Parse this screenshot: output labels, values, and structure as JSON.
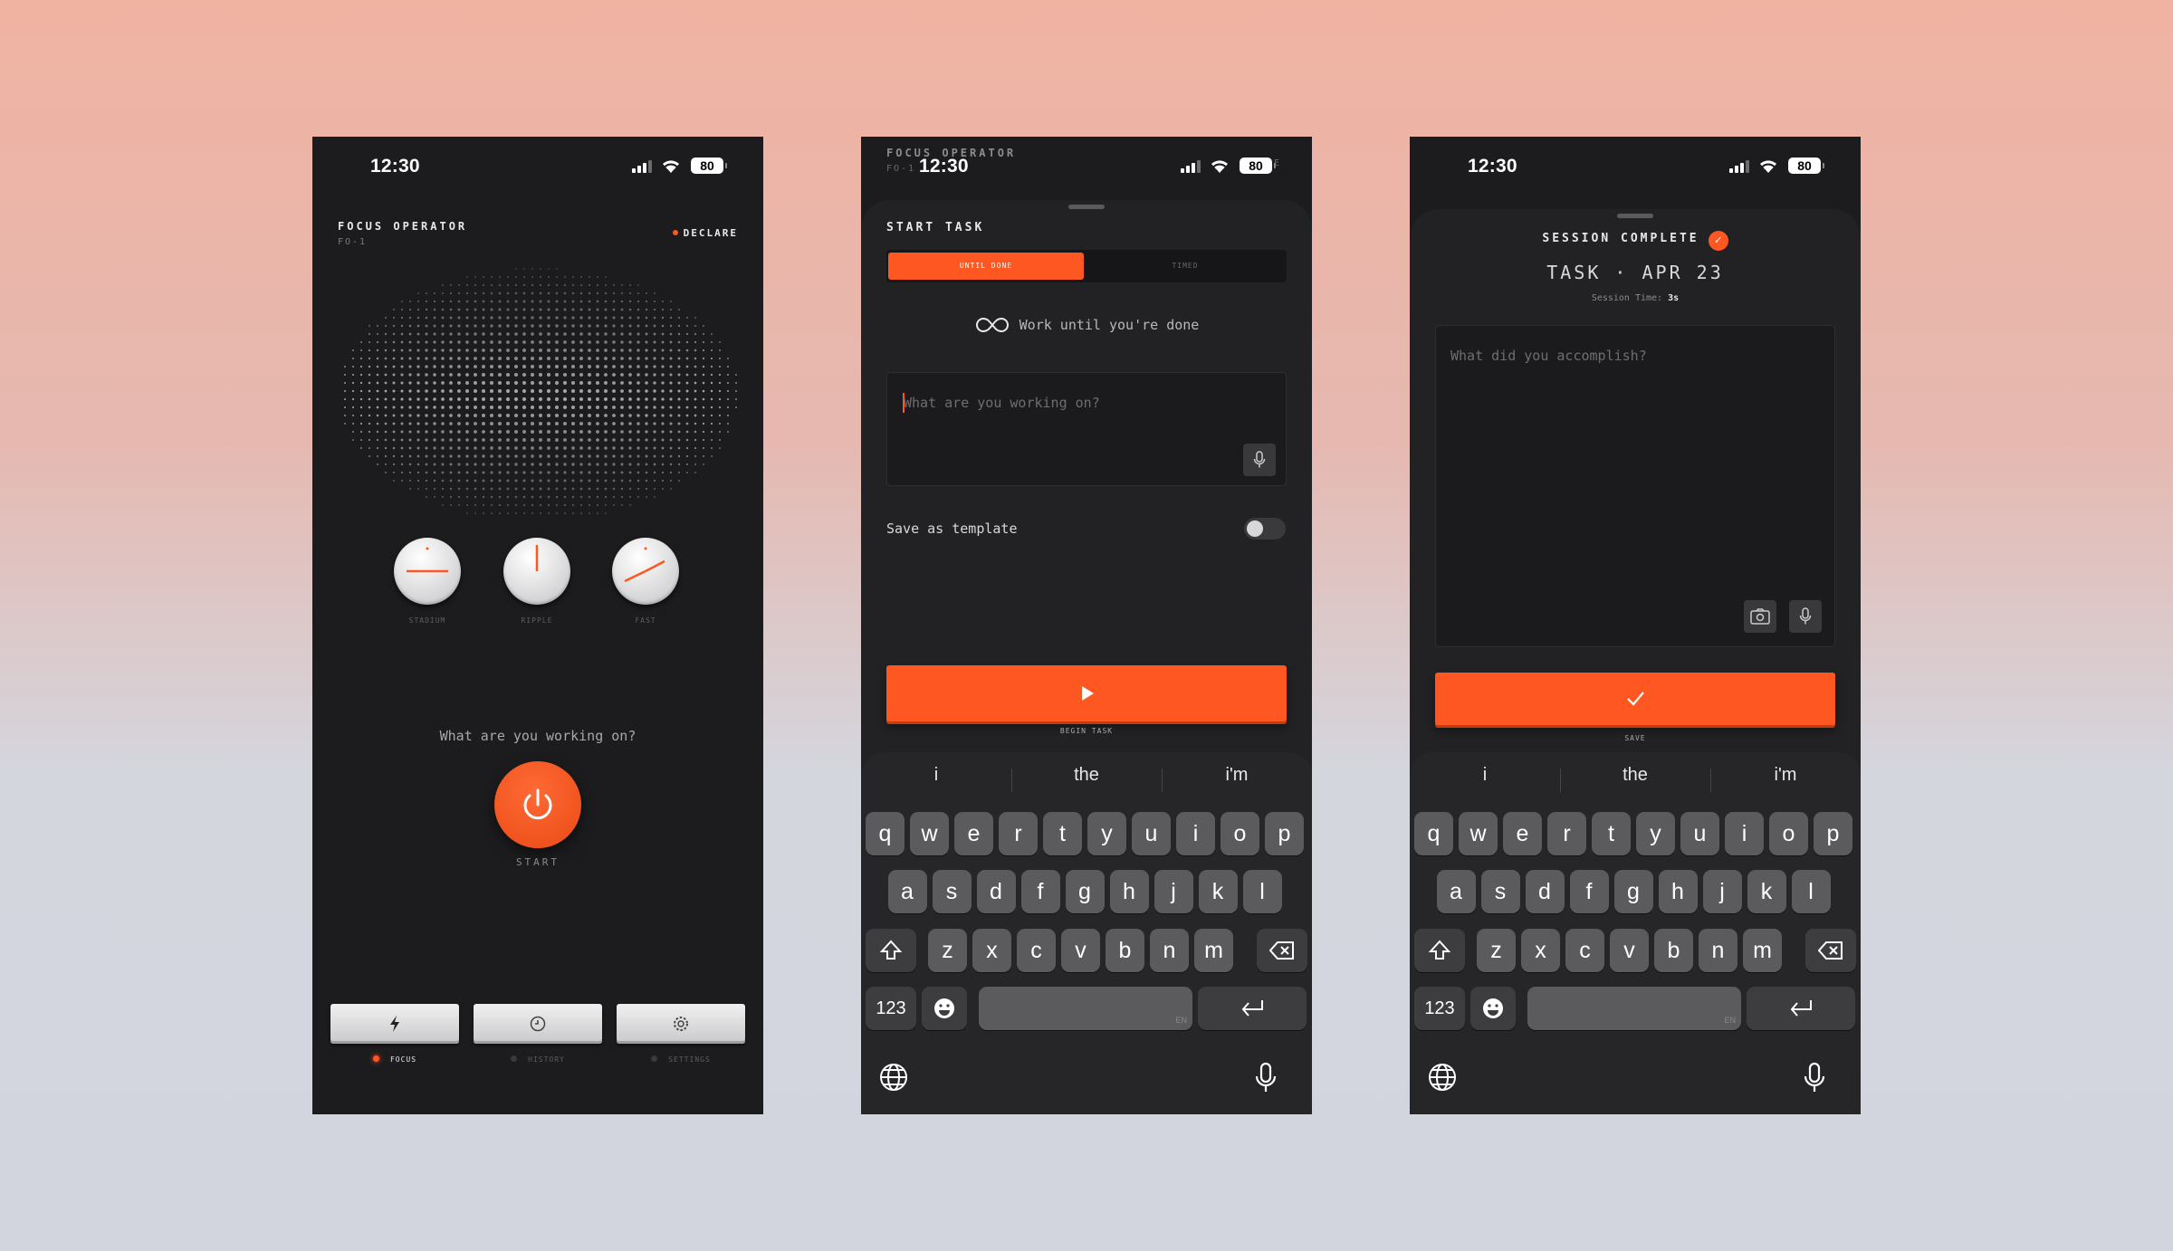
{
  "status": {
    "time": "12:30",
    "battery": "80"
  },
  "colors": {
    "accent": "#ff5722",
    "bg": "#1c1c1e",
    "knob": "#e0e0e2"
  },
  "focus_screen": {
    "title": "FOCUS OPERATOR",
    "subtitle": "FO-1",
    "declare": "DECLARE",
    "knobs": [
      {
        "label": "STADIUM",
        "icon": "dial-icon"
      },
      {
        "label": "RIPPLE",
        "icon": "dial-icon"
      },
      {
        "label": "FAST",
        "icon": "dial-icon"
      }
    ],
    "prompt": "What are you working on?",
    "start_label": "START",
    "nav": [
      {
        "label": "FOCUS",
        "icon": "lightning-icon",
        "active": true
      },
      {
        "label": "HISTORY",
        "icon": "clock-icon",
        "active": false
      },
      {
        "label": "SETTINGS",
        "icon": "gear-icon",
        "active": false
      }
    ]
  },
  "start_task_screen": {
    "bg_title": "FOCUS OPERATOR",
    "bg_subtitle": "FO-1",
    "bg_declare_fragment": "RE",
    "title": "START TASK",
    "tabs": [
      "UNTIL DONE",
      "TIMED"
    ],
    "mode_text": "Work until you're done",
    "input_placeholder": "What are you working on?",
    "template_label": "Save as template",
    "template_enabled": false,
    "begin_label": "BEGIN TASK"
  },
  "session_screen": {
    "title": "SESSION COMPLETE",
    "task_title": "TASK · APR 23",
    "session_time_label": "Session Time:",
    "session_time_value": "3s",
    "input_placeholder": "What did you accomplish?",
    "save_label": "SAVE"
  },
  "keyboard": {
    "suggestions": [
      "i",
      "the",
      "i'm"
    ],
    "row1": [
      "q",
      "w",
      "e",
      "r",
      "t",
      "y",
      "u",
      "i",
      "o",
      "p"
    ],
    "row2": [
      "a",
      "s",
      "d",
      "f",
      "g",
      "h",
      "j",
      "k",
      "l"
    ],
    "row3": [
      "z",
      "x",
      "c",
      "v",
      "b",
      "n",
      "m"
    ],
    "numbers_key": "123",
    "space_lang": "EN"
  }
}
